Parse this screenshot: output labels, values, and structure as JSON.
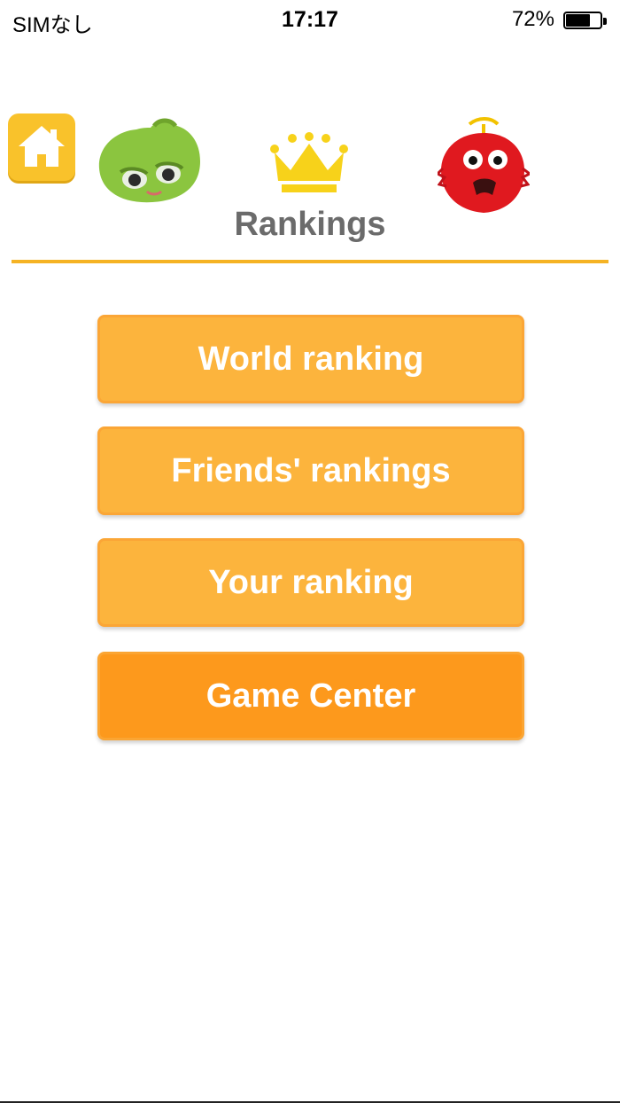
{
  "status_bar": {
    "carrier": "SIMなし",
    "time": "17:17",
    "battery_percent": "72%",
    "battery_level": 0.72
  },
  "header": {
    "home_icon": "home-icon",
    "title": "Rankings",
    "accent_color": "#f5b324"
  },
  "menu": {
    "world_ranking": "World ranking",
    "friends_rankings": "Friends' rankings",
    "your_ranking": "Your ranking",
    "game_center": "Game Center"
  },
  "colors": {
    "button_light": "#fcb43d",
    "button_dark": "#fd991c",
    "home_button": "#f9c22b",
    "title_text": "#6b6b6b"
  }
}
